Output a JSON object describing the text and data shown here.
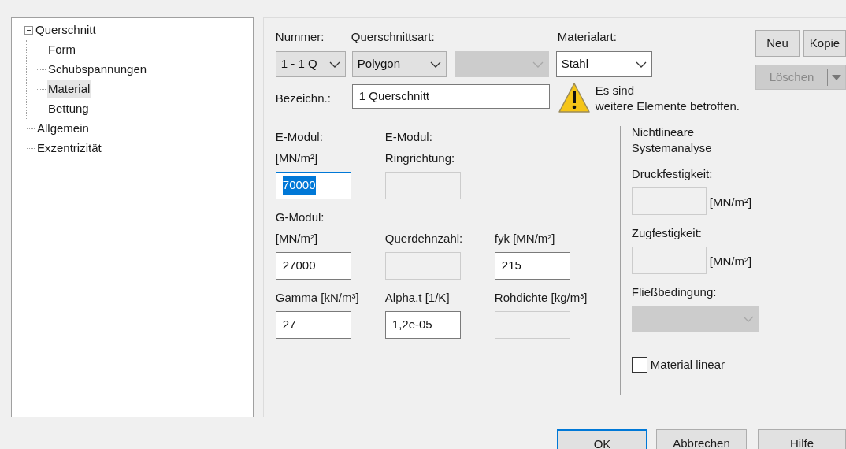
{
  "tree": [
    {
      "label": "Querschnitt",
      "expanded": true,
      "selected": false,
      "children": [
        {
          "label": "Form",
          "selected": false
        },
        {
          "label": "Schubspannungen",
          "selected": false
        },
        {
          "label": "Material",
          "selected": true
        },
        {
          "label": "Bettung",
          "selected": false
        }
      ]
    },
    {
      "label": "Allgemein",
      "selected": false
    },
    {
      "label": "Exzentrizität",
      "selected": false
    }
  ],
  "nummer": {
    "label": "Nummer:",
    "value": "1 - 1 Q",
    "disabled": false
  },
  "querschnittsart": {
    "label": "Querschnittsart:",
    "value": "Polygon",
    "disabled": false
  },
  "subtype": {
    "disabled": true
  },
  "materialart": {
    "label": "Materialart:",
    "value": "Stahl",
    "disabled": false
  },
  "buttons": [
    {
      "label": "Neu",
      "disabled": false,
      "kind": "plain"
    },
    {
      "label": "Kopie",
      "disabled": false,
      "kind": "plain"
    },
    {
      "label": "Löschen",
      "disabled": true,
      "kind": "split"
    }
  ],
  "bezeichnung": {
    "label": "Bezeichn.:",
    "value": "1 Querschnitt"
  },
  "warning": {
    "lines": [
      "Es sind",
      "weitere Elemente betroffen."
    ]
  },
  "fields": [
    [
      {
        "label_lines": [
          "E-Modul:",
          "[MN/m²]"
        ],
        "value": "70000",
        "disabled": false,
        "focused": true
      },
      {
        "label_lines": [
          "E-Modul:",
          "Ringrichtung:"
        ],
        "disabled": true,
        "focused": false
      }
    ],
    [
      {
        "label_lines": [
          "G-Modul:",
          "[MN/m²]"
        ],
        "value": "27000",
        "disabled": false,
        "focused": false
      },
      {
        "label_lines": [
          "Querdehnzahl:"
        ],
        "disabled": true,
        "focused": false
      },
      {
        "label_lines": [
          "fyk [MN/m²]"
        ],
        "value": "215",
        "disabled": false,
        "focused": false
      }
    ],
    [
      {
        "label_lines": [
          "Gamma [kN/m³]"
        ],
        "value": "27",
        "disabled": false,
        "focused": false
      },
      {
        "label_lines": [
          "Alpha.t [1/K]"
        ],
        "value": "1,2e-05",
        "disabled": false,
        "focused": false
      },
      {
        "label_lines": [
          "Rohdichte [kg/m³]"
        ],
        "disabled": true,
        "focused": false
      }
    ]
  ],
  "nonlinear": {
    "title_lines": [
      "Nichtlineare",
      "Systemanalyse"
    ],
    "druck": {
      "label": "Druckfestigkeit:",
      "unit": "[MN/m²]",
      "disabled": true
    },
    "zug": {
      "label": "Zugfestigkeit:",
      "unit": "[MN/m²]",
      "disabled": true
    },
    "fliess": {
      "label": "Fließbedingung:",
      "disabled": true
    },
    "linear": {
      "label": "Material linear",
      "checked": false
    }
  },
  "dialog_buttons": [
    {
      "label": "OK",
      "default": true
    },
    {
      "label": "Abbrechen",
      "default": false
    },
    {
      "label": "Hilfe",
      "default": false
    }
  ]
}
